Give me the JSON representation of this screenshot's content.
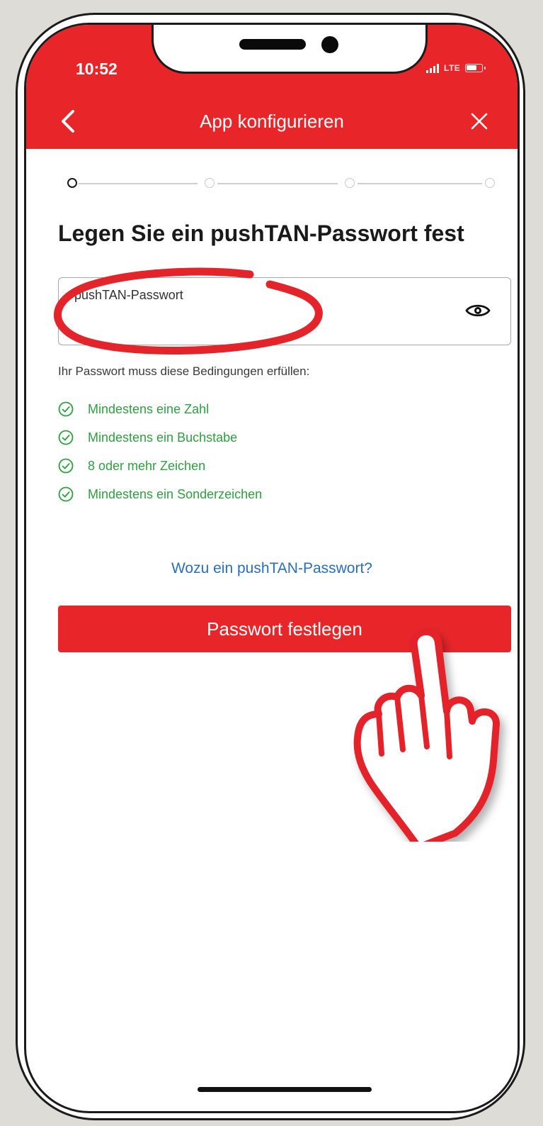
{
  "colors": {
    "brand": "#e8262a",
    "success": "#2e9f3f",
    "link": "#2a6ec2"
  },
  "status_bar": {
    "time": "10:52",
    "network": "LTE",
    "icons": [
      "signal-icon",
      "battery-icon"
    ]
  },
  "header": {
    "title": "App konfigurieren",
    "back_icon": "chevron-left-icon",
    "close_icon": "close-icon"
  },
  "stepper": {
    "total_steps": 4,
    "current_step": 1
  },
  "main": {
    "title": "Legen Sie ein pushTAN-Passwort fest",
    "password_field": {
      "label": "pushTAN-Passwort",
      "value": "",
      "visibility_icon": "eye-icon"
    },
    "requirements_intro": "Ihr Passwort muss diese Bedingungen erfüllen:",
    "requirements": [
      "Mindestens eine Zahl",
      "Mindestens ein Buchstabe",
      "8 oder mehr Zeichen",
      "Mindestens ein Sonderzeichen"
    ],
    "requirement_icon": "check-circle-icon",
    "info_link": "Wozu ein pushTAN-Passwort?",
    "submit_button": "Passwort festlegen"
  },
  "annotations": {
    "highlight": "red-circle-annotation",
    "pointer": "pointing-hand-icon"
  }
}
